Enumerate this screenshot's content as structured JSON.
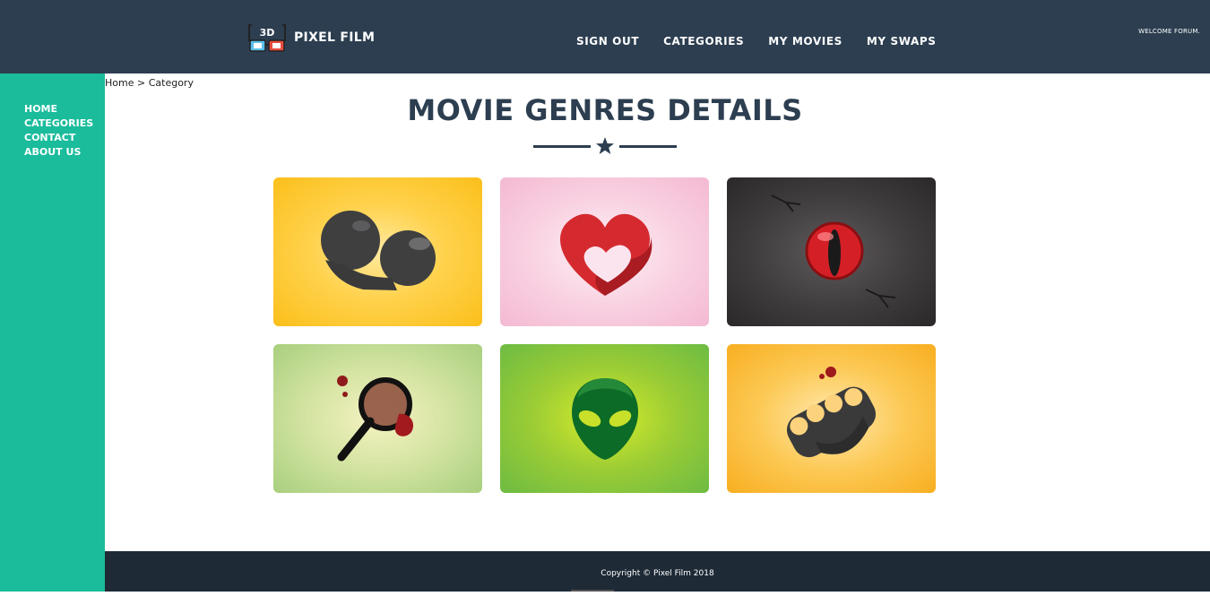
{
  "header": {
    "brand": "PIXEL FILM",
    "logo_icon": "3d-glasses-icon",
    "nav": [
      {
        "label": "SIGN OUT"
      },
      {
        "label": "CATEGORIES"
      },
      {
        "label": "MY MOVIES"
      },
      {
        "label": "MY SWAPS"
      }
    ],
    "welcome": "WELCOME FORUM."
  },
  "sidebar": {
    "items": [
      {
        "label": "HOME"
      },
      {
        "label": "CATEGORIES"
      },
      {
        "label": "CONTACT"
      },
      {
        "label": "ABOUT US"
      }
    ]
  },
  "breadcrumb": {
    "home": "Home",
    "separator": " > ",
    "current": "Category"
  },
  "main": {
    "title": "MOVIE GENRES DETAILS",
    "divider_icon": "star-icon",
    "genres": [
      {
        "icon": "mouse-ears-icon",
        "color": "#fbbf1a"
      },
      {
        "icon": "heart-icon",
        "color": "#f4b9d2"
      },
      {
        "icon": "cat-eye-icon",
        "color": "#2a2828"
      },
      {
        "icon": "magnifying-glass-icon",
        "color": "#a8cf7e"
      },
      {
        "icon": "alien-head-icon",
        "color": "#6dbb43"
      },
      {
        "icon": "brass-knuckles-icon",
        "color": "#f8ae20"
      }
    ]
  },
  "footer": {
    "copyright": "Copyright © Pixel Film 2018"
  },
  "colors": {
    "header_bg": "#2c3e50",
    "sidebar_bg": "#1abc9c",
    "footer_bg": "#1e2a36",
    "title": "#2c3e50"
  }
}
